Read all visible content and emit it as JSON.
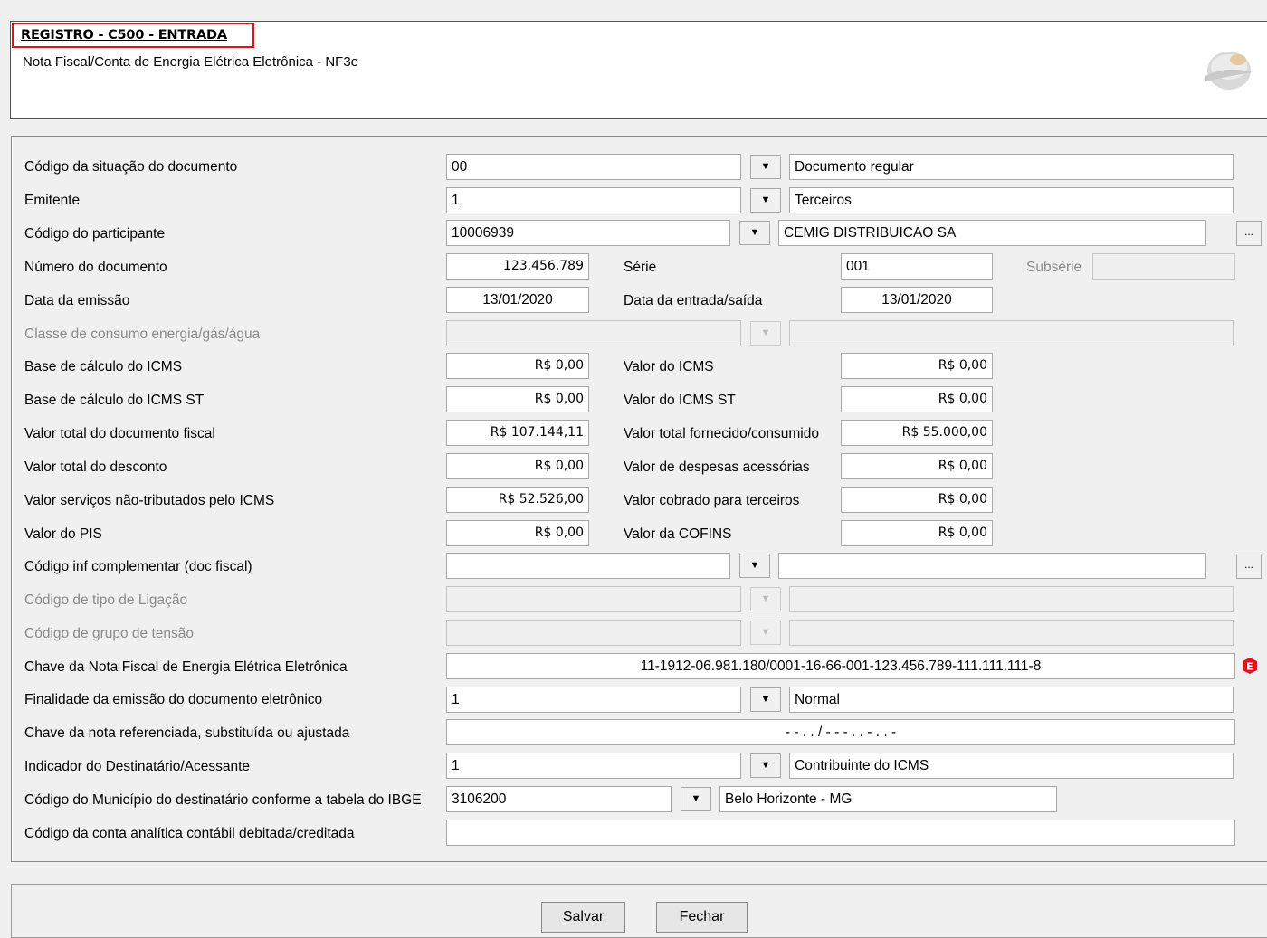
{
  "header": {
    "title": "REGISTRO - C500 - ENTRADA",
    "subtitle": "Nota Fiscal/Conta de Energia Elétrica Eletrônica - NF3e"
  },
  "form": {
    "situacao": {
      "label": "Código da situação do documento",
      "code": "00",
      "desc": "Documento regular"
    },
    "emitente": {
      "label": "Emitente",
      "code": "1",
      "desc": "Terceiros"
    },
    "participante": {
      "label": "Código do participante",
      "code": "10006939",
      "desc": "CEMIG DISTRIBUICAO SA"
    },
    "numero": {
      "label": "Número do documento",
      "value": "123.456.789"
    },
    "serie": {
      "label": "Série",
      "value": "001"
    },
    "subserie": {
      "label": "Subsérie",
      "value": ""
    },
    "data_emissao": {
      "label": "Data da emissão",
      "value": "13/01/2020"
    },
    "data_entrada": {
      "label": "Data da entrada/saída",
      "value": "13/01/2020"
    },
    "classe_consumo": {
      "label": "Classe de consumo energia/gás/água",
      "code": "",
      "desc": ""
    },
    "base_icms": {
      "label": "Base de cálculo do ICMS",
      "value": "R$ 0,00"
    },
    "valor_icms": {
      "label": "Valor do ICMS",
      "value": "R$ 0,00"
    },
    "base_icms_st": {
      "label": "Base de cálculo do ICMS ST",
      "value": "R$ 0,00"
    },
    "valor_icms_st": {
      "label": "Valor do ICMS ST",
      "value": "R$ 0,00"
    },
    "valor_total_doc": {
      "label": "Valor total do documento fiscal",
      "value": "R$ 107.144,11"
    },
    "valor_total_fornecido": {
      "label": "Valor total fornecido/consumido",
      "value": "R$ 55.000,00"
    },
    "valor_desconto": {
      "label": "Valor total do desconto",
      "value": "R$ 0,00"
    },
    "valor_despesas": {
      "label": "Valor de despesas acessórias",
      "value": "R$ 0,00"
    },
    "valor_nao_trib": {
      "label": "Valor serviços não-tributados pelo ICMS",
      "value": "R$ 52.526,00"
    },
    "valor_terceiros": {
      "label": "Valor cobrado para terceiros",
      "value": "R$ 0,00"
    },
    "valor_pis": {
      "label": "Valor do PIS",
      "value": "R$ 0,00"
    },
    "valor_cofins": {
      "label": "Valor da COFINS",
      "value": "R$ 0,00"
    },
    "inf_complementar": {
      "label": "Código inf complementar (doc fiscal)",
      "code": "",
      "desc": ""
    },
    "tipo_ligacao": {
      "label": "Código de tipo de Ligação",
      "code": "",
      "desc": ""
    },
    "grupo_tensao": {
      "label": "Código de grupo de tensão",
      "code": "",
      "desc": ""
    },
    "chave_nf": {
      "label": "Chave da Nota Fiscal de Energia Elétrica Eletrônica",
      "value": "11-1912-06.981.180/0001-16-66-001-123.456.789-111.111.111-8"
    },
    "finalidade": {
      "label": "Finalidade da emissão do documento eletrônico",
      "code": "1",
      "desc": "Normal"
    },
    "chave_ref": {
      "label": "Chave da nota referenciada, substituída ou ajustada",
      "value": "-   - .  .  /    -    -    -    .   .   -   .   .   -"
    },
    "indicador_dest": {
      "label": "Indicador do Destinatário/Acessante",
      "code": "1",
      "desc": "Contribuinte do ICMS"
    },
    "municipio": {
      "label": "Código do Município do destinatário conforme a tabela do IBGE",
      "code": "3106200",
      "desc": "Belo Horizonte - MG"
    },
    "conta_analitica": {
      "label": "Código da conta analítica contábil debitada/creditada",
      "value": ""
    }
  },
  "icons": {
    "dropdown": "chevron-down-icon",
    "more": "ellipsis-icon",
    "error": "error-badge-icon"
  },
  "colors": {
    "accent_border": "#e0141e",
    "error": "#e0141e"
  },
  "buttons": {
    "save": "Salvar",
    "close": "Fechar"
  }
}
